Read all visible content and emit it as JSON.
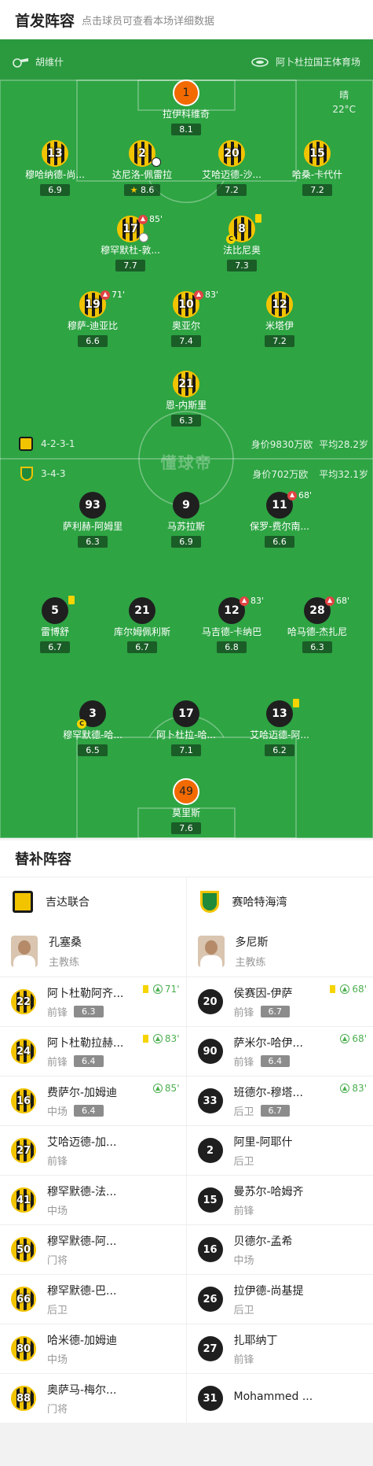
{
  "header": {
    "title": "首发阵容",
    "subtitle": "点击球员可查看本场详细数据"
  },
  "pitch_info": {
    "referee": "胡维什",
    "venue": "阿卜杜拉国王体育场",
    "weather": "晴",
    "temperature": "22°C",
    "home_formation": "4-2-3-1",
    "home_value": "身价9830万欧",
    "home_age": "平均28.2岁",
    "away_formation": "3-4-3",
    "away_value": "身价702万欧",
    "away_age": "平均32.1岁",
    "watermark": "懂球帝"
  },
  "home_players": [
    {
      "num": "1",
      "name": "拉伊科维奇",
      "rating": "8.1"
    },
    {
      "num": "13",
      "name": "穆哈纳德-尚...",
      "rating": "6.9"
    },
    {
      "num": "2",
      "name": "达尼洛-佩雷拉",
      "rating": "8.6"
    },
    {
      "num": "20",
      "name": "艾哈迈德-沙...",
      "rating": "7.2"
    },
    {
      "num": "15",
      "name": "哈桑-卡代什",
      "rating": "7.2"
    },
    {
      "num": "17",
      "name": "穆罕默杜-敦...",
      "rating": "7.7",
      "event": "85'"
    },
    {
      "num": "8",
      "name": "法比尼奥",
      "rating": "7.3"
    },
    {
      "num": "19",
      "name": "穆萨-迪亚比",
      "rating": "6.6",
      "event": "71'"
    },
    {
      "num": "10",
      "name": "奥亚尔",
      "rating": "7.4",
      "event": "83'"
    },
    {
      "num": "12",
      "name": "米塔伊",
      "rating": "7.2"
    },
    {
      "num": "21",
      "name": "恩-内斯里",
      "rating": "6.3"
    }
  ],
  "away_players": [
    {
      "num": "93",
      "name": "萨利赫-阿姆里",
      "rating": "6.3"
    },
    {
      "num": "9",
      "name": "马苏拉斯",
      "rating": "6.9"
    },
    {
      "num": "11",
      "name": "保罗-费尔南...",
      "rating": "6.6",
      "event": "68'"
    },
    {
      "num": "5",
      "name": "雷博舒",
      "rating": "6.7"
    },
    {
      "num": "21",
      "name": "库尔姆佩利斯",
      "rating": "6.7"
    },
    {
      "num": "12",
      "name": "马吉德-卡纳巴",
      "rating": "6.8",
      "event": "83'"
    },
    {
      "num": "28",
      "name": "哈马德-杰扎尼",
      "rating": "6.3",
      "event": "68'"
    },
    {
      "num": "3",
      "name": "穆罕默德-哈...",
      "rating": "6.5"
    },
    {
      "num": "17",
      "name": "阿卜杜拉-哈...",
      "rating": "7.1"
    },
    {
      "num": "13",
      "name": "艾哈迈德-阿...",
      "rating": "6.2"
    },
    {
      "num": "49",
      "name": "莫里斯",
      "rating": "7.6"
    }
  ],
  "subs": {
    "title": "替补阵容",
    "home_team": "吉达联合",
    "away_team": "赛哈特海湾",
    "home_coach": {
      "name": "孔塞桑",
      "role": "主教练"
    },
    "away_coach": {
      "name": "多尼斯",
      "role": "主教练"
    },
    "home": [
      {
        "num": "22",
        "name": "阿卜杜勒阿齐...",
        "pos": "前锋",
        "rating": "6.3",
        "event": "71'"
      },
      {
        "num": "24",
        "name": "阿卜杜勒拉赫...",
        "pos": "前锋",
        "rating": "6.4",
        "event": "83'"
      },
      {
        "num": "16",
        "name": "费萨尔-加姆迪",
        "pos": "中场",
        "rating": "6.4",
        "event": "85'"
      },
      {
        "num": "27",
        "name": "艾哈迈德-加...",
        "pos": "前锋"
      },
      {
        "num": "41",
        "name": "穆罕默德-法...",
        "pos": "中场"
      },
      {
        "num": "50",
        "name": "穆罕默德-阿...",
        "pos": "门将"
      },
      {
        "num": "66",
        "name": "穆罕默德-巴...",
        "pos": "后卫"
      },
      {
        "num": "80",
        "name": "哈米德-加姆迪",
        "pos": "中场"
      },
      {
        "num": "88",
        "name": "奥萨马-梅尔...",
        "pos": "门将"
      }
    ],
    "away": [
      {
        "num": "20",
        "name": "侯赛因-伊萨",
        "pos": "前锋",
        "rating": "6.7",
        "event": "68'"
      },
      {
        "num": "90",
        "name": "萨米尔-哈伊...",
        "pos": "前锋",
        "rating": "6.4",
        "event": "68'"
      },
      {
        "num": "33",
        "name": "班德尔-穆塔...",
        "pos": "后卫",
        "rating": "6.7",
        "event": "83'"
      },
      {
        "num": "2",
        "name": "阿里-阿耶什",
        "pos": "后卫"
      },
      {
        "num": "15",
        "name": "曼苏尔-哈姆齐",
        "pos": "前锋"
      },
      {
        "num": "16",
        "name": "贝德尔-孟希",
        "pos": "中场"
      },
      {
        "num": "26",
        "name": "拉伊德-尚基提",
        "pos": "后卫"
      },
      {
        "num": "27",
        "name": "扎耶纳丁",
        "pos": "前锋"
      },
      {
        "num": "31",
        "name": "Mohammed ...",
        "pos": ""
      }
    ]
  }
}
